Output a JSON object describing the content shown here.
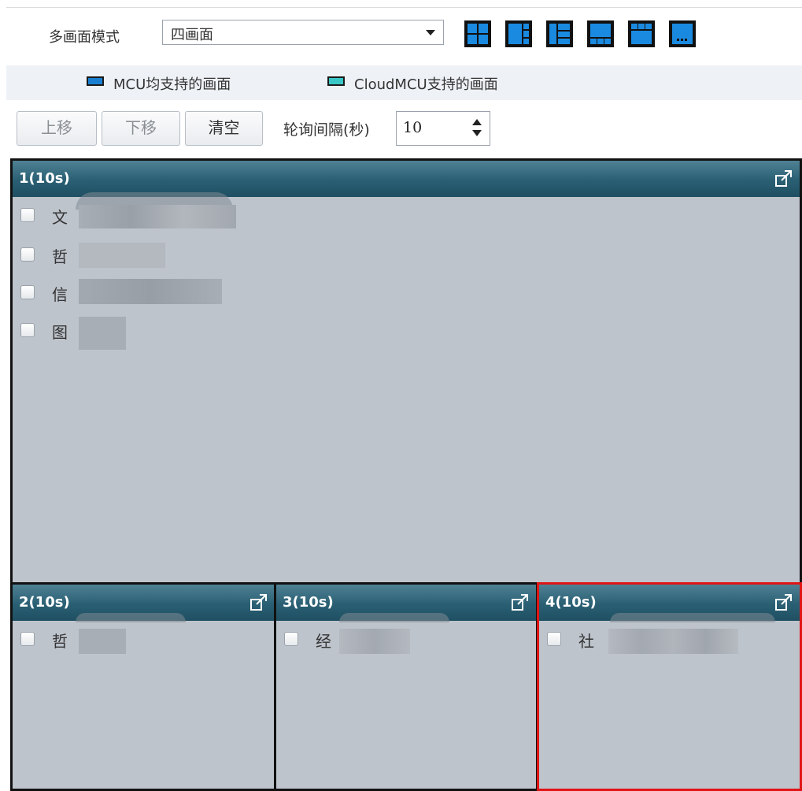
{
  "mode": {
    "label": "多画面模式",
    "selected": "四画面",
    "layout_icons": [
      "layout-2x2-icon",
      "layout-1plus5-icon",
      "layout-1plus3-icon",
      "layout-1plus3-bottom-icon",
      "layout-1plus3-top-icon",
      "layout-1plus4-bottom-icon"
    ]
  },
  "legend": {
    "mcu_label": "MCU均支持的画面",
    "mcu_color": "#1a7fd0",
    "cloud_label": "CloudMCU支持的画面",
    "cloud_color": "#39c6c6"
  },
  "toolbar": {
    "move_up": "上移",
    "move_down": "下移",
    "clear": "清空",
    "interval_label": "轮询间隔(秒)",
    "interval_value": "10"
  },
  "panes": [
    {
      "title": "1(10s)",
      "items": [
        "文",
        "哲",
        "信",
        "图"
      ]
    },
    {
      "title": "2(10s)",
      "items": [
        "哲"
      ]
    },
    {
      "title": "3(10s)",
      "items": [
        "经"
      ]
    },
    {
      "title": "4(10s)",
      "items": [
        "社"
      ]
    }
  ],
  "colors": {
    "selected_border": "#e01515",
    "header": "#2a5f73",
    "pane_bg": "#bec4cc"
  }
}
